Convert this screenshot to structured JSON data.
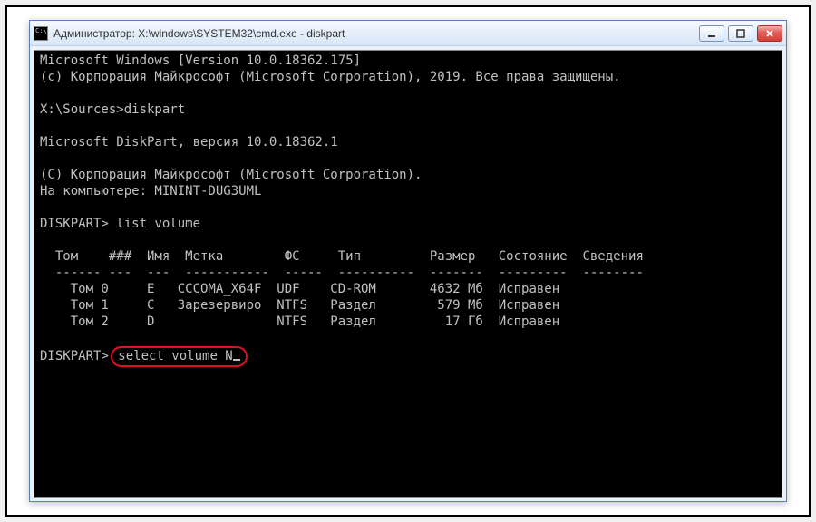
{
  "window": {
    "title": "Администратор: X:\\windows\\SYSTEM32\\cmd.exe - diskpart"
  },
  "terminal": {
    "line1": "Microsoft Windows [Version 10.0.18362.175]",
    "line2": "(c) Корпорация Майкрософт (Microsoft Corporation), 2019. Все права защищены.",
    "blank": "",
    "prompt1": "X:\\Sources>",
    "cmd1": "diskpart",
    "dp_ver": "Microsoft DiskPart, версия 10.0.18362.1",
    "dp_copy": "(C) Корпорация Майкрософт (Microsoft Corporation).",
    "dp_comp": "На компьютере: MININT-DUG3UML",
    "prompt2": "DISKPART> ",
    "cmd2": "list volume",
    "hdr": "  Том    ###  Имя  Метка        ФС     Тип         Размер   Состояние  Сведения",
    "rule": "  ------ ---  ---  -----------  -----  ----------  -------  ---------  --------",
    "r0": "    Том 0     E   CCCOMA_X64F  UDF    CD-ROM       4632 Мб  Исправен",
    "r1": "    Том 1     C   Зарезервиро  NTFS   Раздел        579 Мб  Исправен",
    "r2": "    Том 2     D                NTFS   Раздел         17 Гб  Исправен",
    "prompt3": "DISKPART> ",
    "cmd3": "select volume N"
  }
}
